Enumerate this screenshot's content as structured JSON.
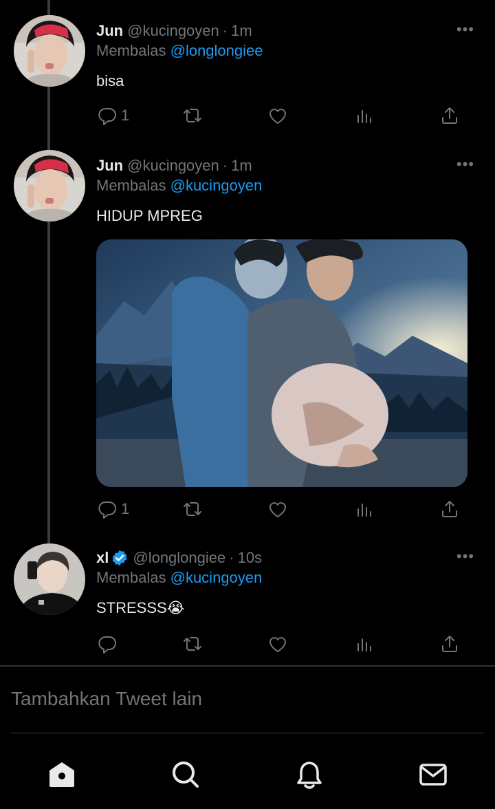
{
  "tweets": [
    {
      "name": "Jun",
      "handle": "@kucingoyen",
      "dot": "·",
      "time": "1m",
      "more": "•••",
      "reply_prefix": "Membalas",
      "reply_handle": "@longlongiee",
      "text": "bisa",
      "reply_count": "1"
    },
    {
      "name": "Jun",
      "handle": "@kucingoyen",
      "dot": "·",
      "time": "1m",
      "more": "•••",
      "reply_prefix": "Membalas",
      "reply_handle": "@kucingoyen",
      "text": "HIDUP MPREG",
      "reply_count": "1"
    },
    {
      "name": "xl",
      "verified": true,
      "handle": "@longlongiee",
      "dot": "·",
      "time": "10s",
      "more": "•••",
      "reply_prefix": "Membalas",
      "reply_handle": "@kucingoyen",
      "text": "STRESSS😭",
      "reply_count": ""
    }
  ],
  "compose": {
    "placeholder": "Tambahkan Tweet lain"
  },
  "icons": {
    "reply": "reply-icon",
    "retweet": "retweet-icon",
    "like": "heart-icon",
    "views": "views-icon",
    "share": "share-icon",
    "home": "home-icon",
    "search": "search-icon",
    "notifications": "bell-icon",
    "messages": "mail-icon"
  },
  "colors": {
    "background": "#000000",
    "text": "#e7e9ea",
    "muted": "#71767b",
    "link": "#1d9bf0",
    "verified": "#1d9bf0"
  }
}
